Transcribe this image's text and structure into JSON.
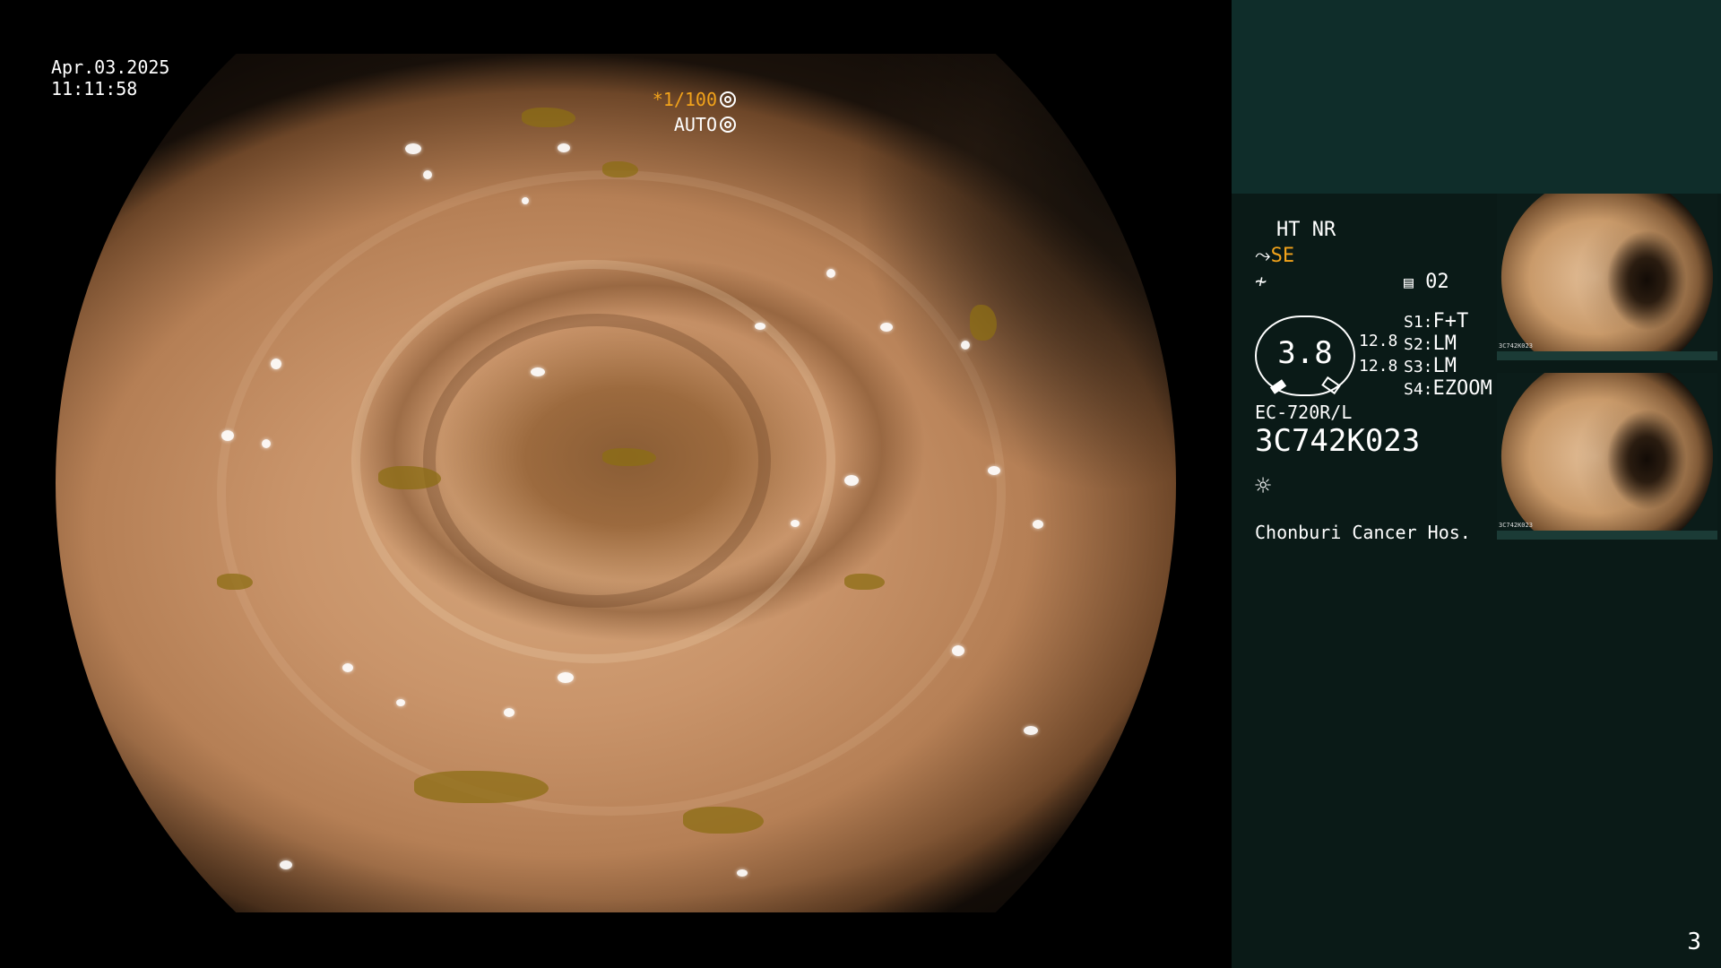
{
  "overlay": {
    "date": "Apr.03.2025",
    "time": "11:11:58",
    "shutter": "*1/100",
    "exposure_mode": "AUTO"
  },
  "panel": {
    "mode_line": "HT NR",
    "enhance": "SE",
    "memory": "02",
    "gauge_value": "3.8",
    "gauge_side_1": "12.8",
    "gauge_side_2": "12.8",
    "switches": [
      {
        "key": "S1:",
        "value": "F+T"
      },
      {
        "key": "S2:",
        "value": "LM"
      },
      {
        "key": "S3:",
        "value": "LM"
      },
      {
        "key": "S4:",
        "value": "EZOOM"
      }
    ],
    "scope_model": "EC-720R/L",
    "scope_serial": "3C742K023",
    "hospital": "Chonburi Cancer Hos."
  },
  "thumbnails": [
    {
      "label": "3C742K023"
    },
    {
      "label": "3C742K023"
    }
  ],
  "page_number": "3",
  "colors": {
    "panel_bg": "#0a1a17",
    "panel_top": "#0f2d2a",
    "accent_orange": "#f2a31b"
  }
}
